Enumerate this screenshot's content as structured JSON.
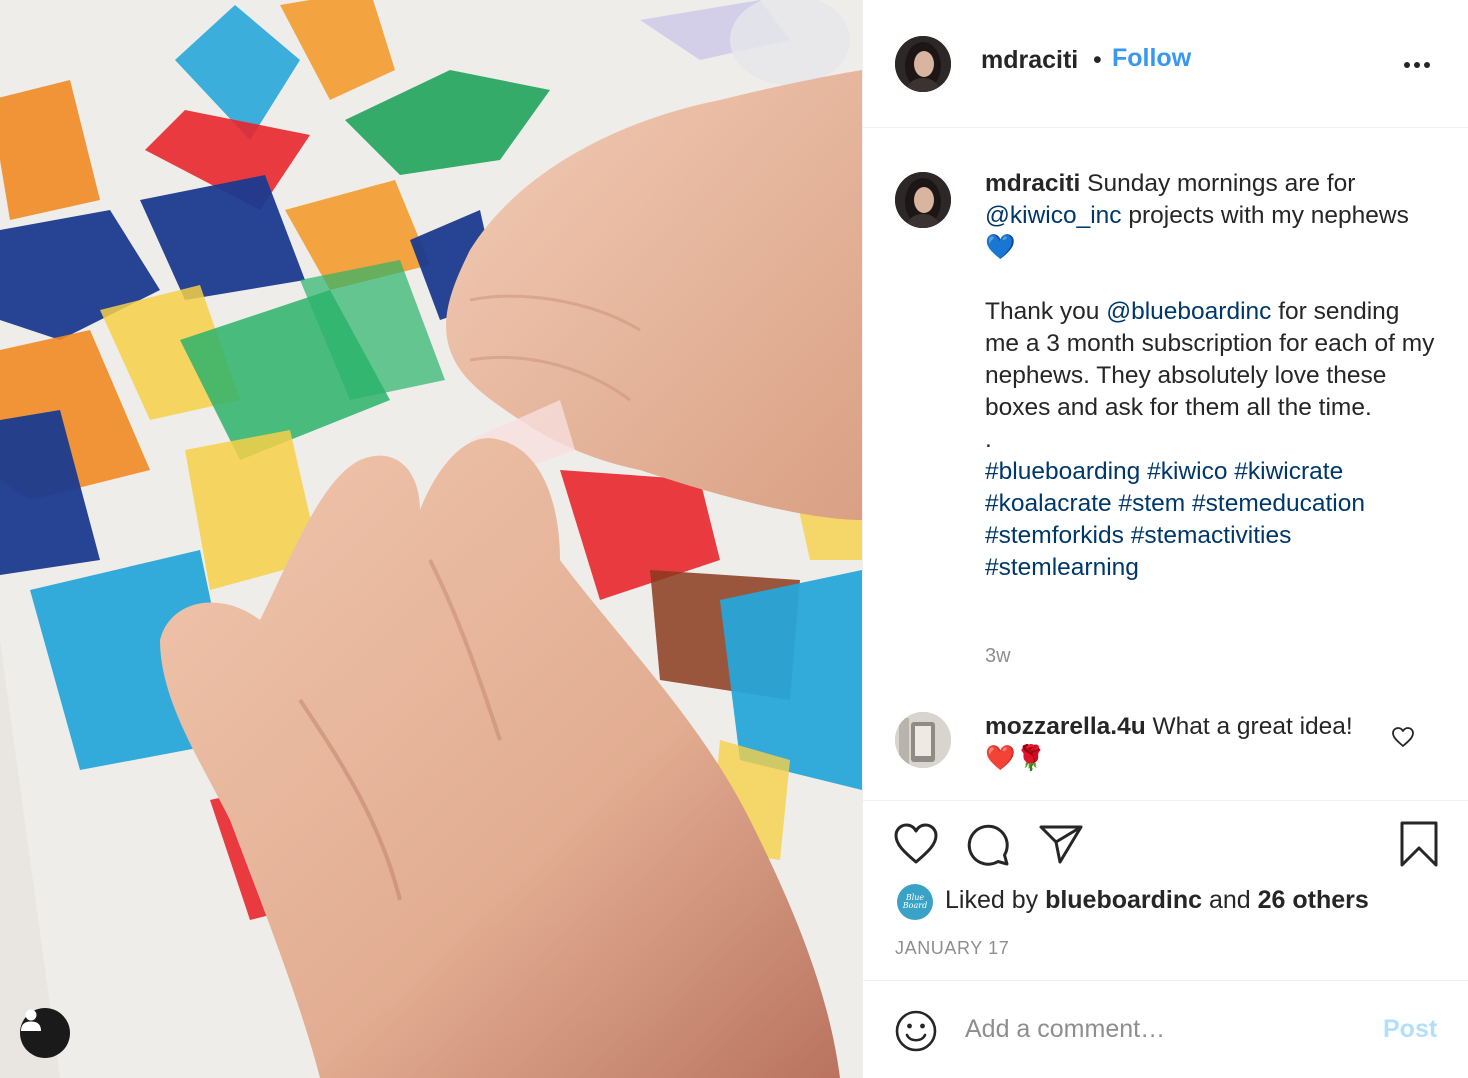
{
  "post": {
    "username": "mdraciti",
    "separator": "•",
    "follow_label": "Follow",
    "more_icon": "more-horizontal-icon"
  },
  "caption": {
    "username": "mdraciti",
    "line1_text": " Sunday mornings are for ",
    "mention1": "@kiwico_inc",
    "line1_text_after": " projects with my nephews ",
    "heart_emoji": "💙",
    "para2_before": "Thank you ",
    "mention2": "@blueboardinc",
    "para2_after": " for sending me a 3 month subscription for each of my nephews. They absolutely love these boxes and ask for them all the time.",
    "dot_line": ".",
    "hashtags": [
      "#blueboarding",
      "#kiwico",
      "#kiwicrate",
      "#koalacrate",
      "#stem",
      "#stemeducation",
      "#stemforkids",
      "#stemactivities",
      "#stemlearning"
    ],
    "time_ago": "3w"
  },
  "comments": [
    {
      "username": "mozzarella.4u",
      "text": " What a great idea! ",
      "emojis": "❤️🌹"
    }
  ],
  "actions": {
    "like_icon": "heart-icon",
    "comment_icon": "comment-icon",
    "share_icon": "share-icon",
    "save_icon": "bookmark-icon"
  },
  "likes": {
    "prefix": "Liked by ",
    "user": "blueboardinc",
    "middle": " and ",
    "others": "26 others",
    "avatar_text": "Blue Board"
  },
  "date": "JANUARY 17",
  "add_comment": {
    "placeholder": "Add a comment…",
    "post_label": "Post"
  },
  "colors": {
    "follow": "#3897f0",
    "link": "#00376b",
    "post_disabled": "#b2dffc",
    "muted": "#8e8e8e"
  }
}
